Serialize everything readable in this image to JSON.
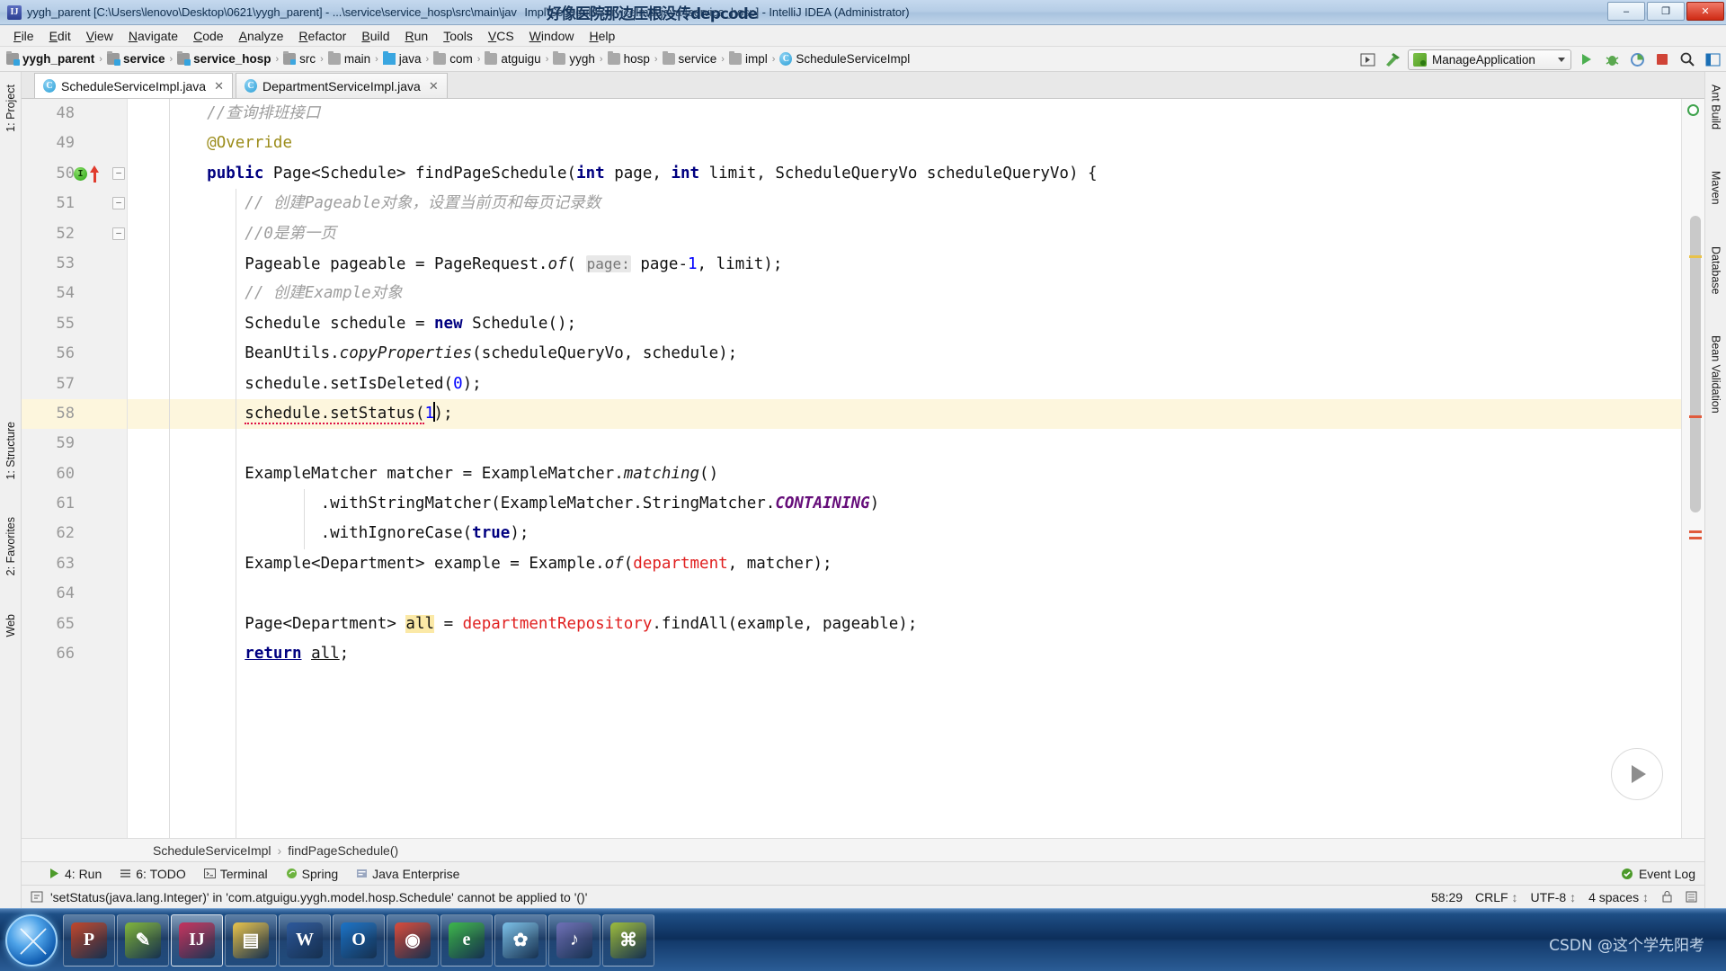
{
  "window": {
    "title": "yygh_parent [C:\\Users\\lenovo\\Desktop\\0621\\yygh_parent] - ...\\service\\service_hosp\\src\\main\\jav",
    "title_tail": "Impl\\ScheduleServiceImpl.java [service_hosp] - IntelliJ IDEA (Administrator)",
    "overlay_note": "好像医院那边压根没传depcode",
    "app_icon": "IJ",
    "minimize": "–",
    "maximize": "❐",
    "close": "✕"
  },
  "menu": [
    "File",
    "Edit",
    "View",
    "Navigate",
    "Code",
    "Analyze",
    "Refactor",
    "Build",
    "Run",
    "Tools",
    "VCS",
    "Window",
    "Help"
  ],
  "breadcrumb": [
    {
      "label": "yygh_parent",
      "icon": "module-icon",
      "bold": true
    },
    {
      "label": "service",
      "icon": "module-icon",
      "bold": true
    },
    {
      "label": "service_hosp",
      "icon": "module-icon",
      "bold": true
    },
    {
      "label": "src",
      "icon": "folder-src-icon",
      "bold": false
    },
    {
      "label": "main",
      "icon": "folder-icon",
      "bold": false
    },
    {
      "label": "java",
      "icon": "folder-java-icon",
      "bold": false
    },
    {
      "label": "com",
      "icon": "folder-icon",
      "bold": false
    },
    {
      "label": "atguigu",
      "icon": "folder-icon",
      "bold": false
    },
    {
      "label": "yygh",
      "icon": "folder-icon",
      "bold": false
    },
    {
      "label": "hosp",
      "icon": "folder-icon",
      "bold": false
    },
    {
      "label": "service",
      "icon": "folder-icon",
      "bold": false
    },
    {
      "label": "impl",
      "icon": "folder-icon",
      "bold": false
    },
    {
      "label": "ScheduleServiceImpl",
      "icon": "class-icon",
      "bold": false
    }
  ],
  "toolbar": {
    "run_config": "ManageApplication",
    "buttons": [
      "open-preview-icon",
      "build-hammer-icon",
      "run-icon",
      "debug-icon",
      "run-coverage-icon",
      "stop-icon",
      "search-icon",
      "layout-icon"
    ]
  },
  "tabs": [
    {
      "label": "ScheduleServiceImpl.java",
      "active": true,
      "close": "✕"
    },
    {
      "label": "DepartmentServiceImpl.java",
      "active": false,
      "close": "✕"
    }
  ],
  "left_rail": [
    {
      "label": "1: Project",
      "icon": "project-icon"
    },
    {
      "label": "1: Structure",
      "icon": "structure-icon"
    },
    {
      "label": "2: Favorites",
      "icon": "star-icon"
    },
    {
      "label": "Web",
      "icon": "web-icon"
    }
  ],
  "right_rail": [
    {
      "label": "Ant Build",
      "icon": "ant-icon"
    },
    {
      "label": "Maven",
      "icon": "maven-icon"
    },
    {
      "label": "Database",
      "icon": "database-icon"
    },
    {
      "label": "Bean Validation",
      "icon": "bean-icon"
    }
  ],
  "editor": {
    "first_line": 48,
    "highlight_line": 58,
    "lines": [
      {
        "n": 48,
        "indent": 1,
        "tokens": [
          {
            "t": "//查询排班接口",
            "c": "cmt"
          }
        ]
      },
      {
        "n": 49,
        "indent": 1,
        "tokens": [
          {
            "t": "@Override",
            "c": "ann"
          }
        ]
      },
      {
        "n": 50,
        "indent": 1,
        "marker": "breakpoint-and-override-arrow",
        "fold": true,
        "tokens": [
          {
            "t": "public ",
            "c": "kw"
          },
          {
            "t": "Page<Schedule> findPageSchedule(",
            "c": ""
          },
          {
            "t": "int",
            "c": "kw"
          },
          {
            "t": " page, ",
            "c": ""
          },
          {
            "t": "int",
            "c": "kw"
          },
          {
            "t": " limit, ScheduleQueryVo scheduleQueryVo) {",
            "c": ""
          }
        ]
      },
      {
        "n": 51,
        "indent": 2,
        "fold": true,
        "tokens": [
          {
            "t": "// 创建Pageable对象，设置当前页和每页记录数",
            "c": "cmt"
          }
        ]
      },
      {
        "n": 52,
        "indent": 2,
        "fold": true,
        "tokens": [
          {
            "t": "//0是第一页",
            "c": "cmt"
          }
        ]
      },
      {
        "n": 53,
        "indent": 2,
        "tokens": [
          {
            "t": "Pageable pageable = PageRequest.",
            "c": ""
          },
          {
            "t": "of",
            "c": "mth"
          },
          {
            "t": "( ",
            "c": ""
          },
          {
            "t": "page:",
            "c": "hint"
          },
          {
            "t": " page-",
            "c": ""
          },
          {
            "t": "1",
            "c": "num"
          },
          {
            "t": ", limit);",
            "c": ""
          }
        ]
      },
      {
        "n": 54,
        "indent": 2,
        "tokens": [
          {
            "t": "// 创建Example对象",
            "c": "cmt"
          }
        ]
      },
      {
        "n": 55,
        "indent": 2,
        "tokens": [
          {
            "t": "Schedule schedule = ",
            "c": ""
          },
          {
            "t": "new",
            "c": "kw"
          },
          {
            "t": " Schedule();",
            "c": ""
          }
        ]
      },
      {
        "n": 56,
        "indent": 2,
        "tokens": [
          {
            "t": "BeanUtils.",
            "c": ""
          },
          {
            "t": "copyProperties",
            "c": "mth"
          },
          {
            "t": "(scheduleQueryVo, schedule);",
            "c": ""
          }
        ]
      },
      {
        "n": 57,
        "indent": 2,
        "tokens": [
          {
            "t": "schedule.setIsDeleted(",
            "c": ""
          },
          {
            "t": "0",
            "c": "num"
          },
          {
            "t": ");",
            "c": ""
          }
        ]
      },
      {
        "n": 58,
        "indent": 2,
        "highlight": true,
        "caret": true,
        "tokens": [
          {
            "t": "schedule.setStatus(",
            "c": "errsquig"
          },
          {
            "t": "1",
            "c": "num"
          },
          {
            "t": ");",
            "c": ""
          }
        ]
      },
      {
        "n": 59,
        "indent": 2,
        "tokens": []
      },
      {
        "n": 60,
        "indent": 2,
        "tokens": [
          {
            "t": "ExampleMatcher matcher = ExampleMatcher.",
            "c": ""
          },
          {
            "t": "matching",
            "c": "mth"
          },
          {
            "t": "()",
            "c": ""
          }
        ]
      },
      {
        "n": 61,
        "indent": 4,
        "tokens": [
          {
            "t": ".withStringMatcher(ExampleMatcher.StringMatcher.",
            "c": ""
          },
          {
            "t": "CONTAINING",
            "c": "stat"
          },
          {
            "t": ")",
            "c": ""
          }
        ]
      },
      {
        "n": 62,
        "indent": 4,
        "tokens": [
          {
            "t": ".withIgnoreCase(",
            "c": ""
          },
          {
            "t": "true",
            "c": "kw"
          },
          {
            "t": ");",
            "c": ""
          }
        ]
      },
      {
        "n": 63,
        "indent": 2,
        "tokens": [
          {
            "t": "Example<Department> example = Example.",
            "c": ""
          },
          {
            "t": "of",
            "c": "mth"
          },
          {
            "t": "(",
            "c": ""
          },
          {
            "t": "department",
            "c": "err"
          },
          {
            "t": ", matcher);",
            "c": ""
          }
        ]
      },
      {
        "n": 64,
        "indent": 2,
        "tokens": []
      },
      {
        "n": 65,
        "indent": 2,
        "tokens": [
          {
            "t": "Page<Department> ",
            "c": ""
          },
          {
            "t": "all",
            "c": "sel"
          },
          {
            "t": " = ",
            "c": ""
          },
          {
            "t": "departmentRepository",
            "c": "err"
          },
          {
            "t": ".findAll(example, pageable);",
            "c": ""
          }
        ]
      },
      {
        "n": 66,
        "indent": 2,
        "tokens": [
          {
            "t": "return",
            "c": "kw-u"
          },
          {
            "t": " ",
            "c": ""
          },
          {
            "t": "all",
            "c": "u"
          },
          {
            "t": ";",
            "c": ""
          }
        ]
      }
    ],
    "crumb": [
      "ScheduleServiceImpl",
      "findPageSchedule()"
    ],
    "crumb_sep": "›"
  },
  "tool_windows": [
    {
      "label": "4: Run",
      "icon": "run-icon"
    },
    {
      "label": "6: TODO",
      "icon": "todo-icon"
    },
    {
      "label": "Terminal",
      "icon": "terminal-icon"
    },
    {
      "label": "Spring",
      "icon": "spring-icon"
    },
    {
      "label": "Java Enterprise",
      "icon": "java-enterprise-icon"
    }
  ],
  "event_log": "Event Log",
  "status": {
    "message": "'setStatus(java.lang.Integer)' in 'com.atguigu.yygh.model.hosp.Schedule' cannot be applied to '()'",
    "caret_position": "58:29",
    "line_separator": "CRLF",
    "encoding": "UTF-8",
    "indent": "4 spaces",
    "chevron": "↕"
  },
  "taskbar": {
    "start": "start-orb",
    "items": [
      {
        "name": "powerpoint-icon",
        "glyph": "P",
        "color": "#c0452a",
        "active": false
      },
      {
        "name": "notepad-icon",
        "glyph": "✎",
        "color": "#7fb43a",
        "active": false
      },
      {
        "name": "intellij-idea-icon",
        "glyph": "IJ",
        "color": "#c3305c",
        "active": true
      },
      {
        "name": "file-explorer-icon",
        "glyph": "▤",
        "color": "#e8c34a",
        "active": false
      },
      {
        "name": "word-icon",
        "glyph": "W",
        "color": "#2b579a",
        "active": false
      },
      {
        "name": "outlook-icon",
        "glyph": "O",
        "color": "#1a72c6",
        "active": false
      },
      {
        "name": "media-icon",
        "glyph": "◉",
        "color": "#d94a3a",
        "active": false
      },
      {
        "name": "edge-icon",
        "glyph": "e",
        "color": "#3bb54a",
        "active": false
      },
      {
        "name": "paint-icon",
        "glyph": "✿",
        "color": "#7ac0e8",
        "active": false
      },
      {
        "name": "navicat-icon",
        "glyph": "♪",
        "color": "#6d6fb6",
        "active": false
      },
      {
        "name": "xshell-icon",
        "glyph": "⌘",
        "color": "#9bbb3c",
        "active": false
      }
    ],
    "watermark": "CSDN @这个学先阳考"
  }
}
